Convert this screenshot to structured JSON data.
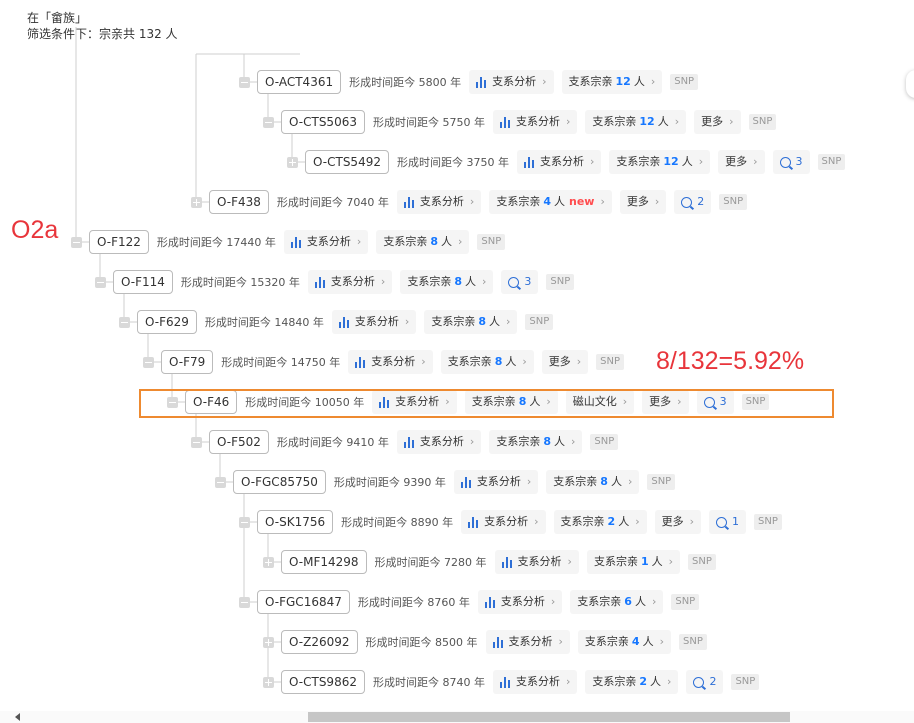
{
  "header": {
    "line1": "在「畲族」",
    "line2": "筛选条件下：宗亲共 132 人"
  },
  "labels": {
    "analysis": "支系分析",
    "clan_prefix": "支系宗亲",
    "clan_suffix": "人",
    "more": "更多",
    "snp": "SNP",
    "new": "new",
    "age_prefix": "形成时间距今"
  },
  "annotations": {
    "haplogroup": "O2a",
    "ratio": "8/132=5.92%"
  },
  "colors": {
    "accent": "#1677ff",
    "annotation": "#e8353b",
    "highlight": "#ee8a30"
  },
  "rows": [
    {
      "id": "O-ACT4361",
      "age": "形成时间距今 5800 年",
      "clan": "12",
      "more": false,
      "comments": null,
      "new": false,
      "culture": null,
      "expanded": true,
      "highlighted": false
    },
    {
      "id": "O-CTS5063",
      "age": "形成时间距今 5750 年",
      "clan": "12",
      "more": true,
      "comments": null,
      "new": false,
      "culture": null,
      "expanded": true,
      "highlighted": false
    },
    {
      "id": "O-CTS5492",
      "age": "形成时间距今 3750 年",
      "clan": "12",
      "more": true,
      "comments": "3",
      "new": false,
      "culture": null,
      "expanded": false,
      "highlighted": false
    },
    {
      "id": "O-F438",
      "age": "形成时间距今 7040 年",
      "clan": "4",
      "more": true,
      "comments": "2",
      "new": true,
      "culture": null,
      "expanded": false,
      "highlighted": false
    },
    {
      "id": "O-F122",
      "age": "形成时间距今 17440 年",
      "clan": "8",
      "more": false,
      "comments": null,
      "new": false,
      "culture": null,
      "expanded": true,
      "highlighted": false
    },
    {
      "id": "O-F114",
      "age": "形成时间距今 15320 年",
      "clan": "8",
      "more": false,
      "comments": "3",
      "new": false,
      "culture": null,
      "expanded": true,
      "highlighted": false
    },
    {
      "id": "O-F629",
      "age": "形成时间距今 14840 年",
      "clan": "8",
      "more": false,
      "comments": null,
      "new": false,
      "culture": null,
      "expanded": true,
      "highlighted": false
    },
    {
      "id": "O-F79",
      "age": "形成时间距今 14750 年",
      "clan": "8",
      "more": true,
      "comments": null,
      "new": false,
      "culture": null,
      "expanded": true,
      "highlighted": false
    },
    {
      "id": "O-F46",
      "age": "形成时间距今 10050 年",
      "clan": "8",
      "more": true,
      "comments": "3",
      "new": false,
      "culture": "磁山文化",
      "expanded": true,
      "highlighted": true
    },
    {
      "id": "O-F502",
      "age": "形成时间距今 9410 年",
      "clan": "8",
      "more": false,
      "comments": null,
      "new": false,
      "culture": null,
      "expanded": true,
      "highlighted": false
    },
    {
      "id": "O-FGC85750",
      "age": "形成时间距今 9390 年",
      "clan": "8",
      "more": false,
      "comments": null,
      "new": false,
      "culture": null,
      "expanded": true,
      "highlighted": false
    },
    {
      "id": "O-SK1756",
      "age": "形成时间距今 8890 年",
      "clan": "2",
      "more": true,
      "comments": "1",
      "new": false,
      "culture": null,
      "expanded": true,
      "highlighted": false
    },
    {
      "id": "O-MF14298",
      "age": "形成时间距今 7280 年",
      "clan": "1",
      "more": false,
      "comments": null,
      "new": false,
      "culture": null,
      "expanded": false,
      "highlighted": false
    },
    {
      "id": "O-FGC16847",
      "age": "形成时间距今 8760 年",
      "clan": "6",
      "more": false,
      "comments": null,
      "new": false,
      "culture": null,
      "expanded": true,
      "highlighted": false
    },
    {
      "id": "O-Z26092",
      "age": "形成时间距今 8500 年",
      "clan": "4",
      "more": false,
      "comments": null,
      "new": false,
      "culture": null,
      "expanded": false,
      "highlighted": false
    },
    {
      "id": "O-CTS9862",
      "age": "形成时间距今 8740 年",
      "clan": "2",
      "more": false,
      "comments": "2",
      "new": false,
      "culture": null,
      "expanded": false,
      "highlighted": false
    }
  ]
}
